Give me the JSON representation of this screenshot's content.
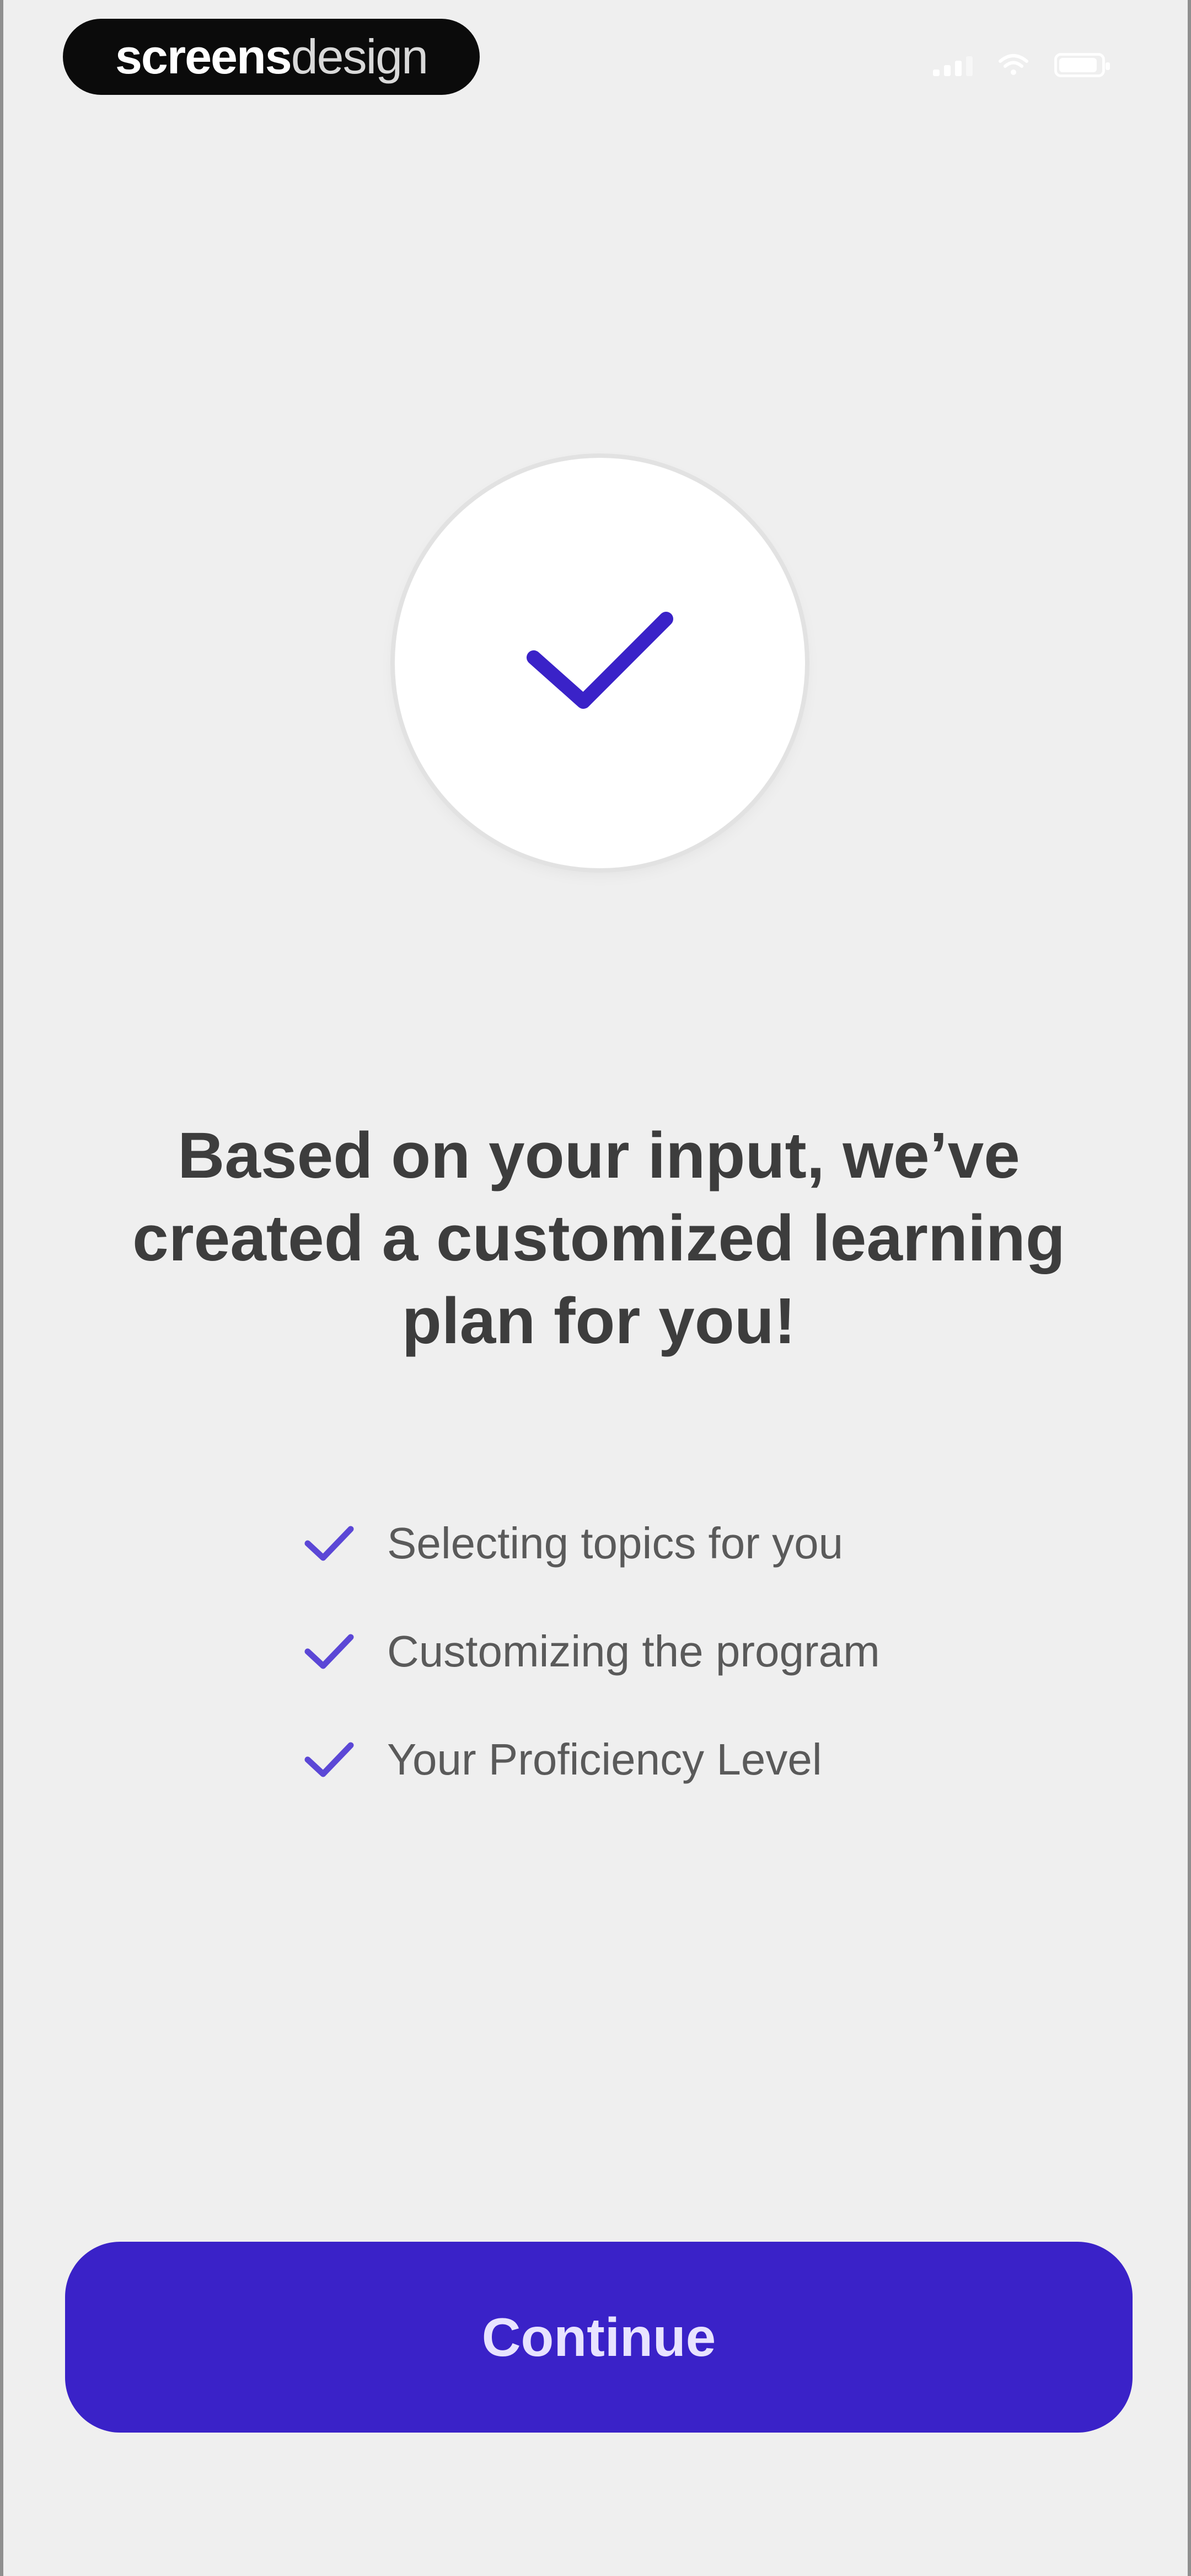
{
  "status_bar": {
    "logo_bold": "screens",
    "logo_light": "design"
  },
  "hero": {
    "icon": "checkmark-icon",
    "accent_color": "#3a22c8"
  },
  "headline": "Based on your input, we’ve created a customized learning plan for you!",
  "checklist": {
    "items": [
      {
        "icon": "check-icon",
        "label": "Selecting topics for you"
      },
      {
        "icon": "check-icon",
        "label": "Customizing the program"
      },
      {
        "icon": "check-icon",
        "label": "Your Proficiency Level"
      }
    ]
  },
  "footer": {
    "continue_label": "Continue",
    "button_color": "#3a22c8"
  }
}
